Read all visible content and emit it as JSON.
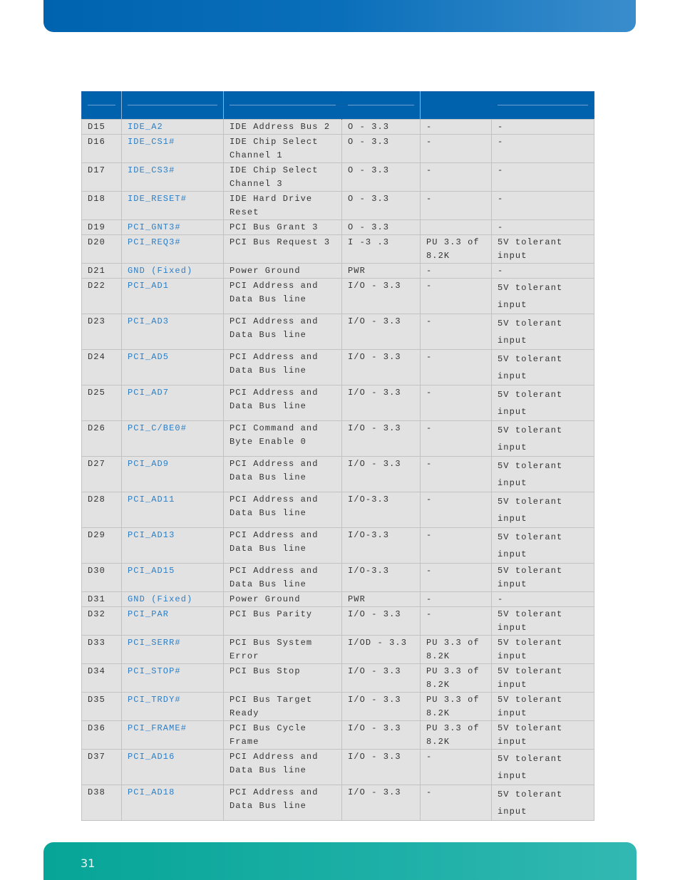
{
  "page_number": "31",
  "colors": {
    "header_band": "#0063b0",
    "footer_band": "#06a597",
    "table_header": "#0062ad",
    "signal_link": "#2e7ec4",
    "cell_bg": "#e2e2e2"
  },
  "table": {
    "headers": [
      "",
      "",
      "",
      "",
      "",
      ""
    ],
    "rows": [
      [
        "D15",
        "IDE_A2",
        "IDE Address Bus 2",
        "O - 3.3",
        "-",
        "-"
      ],
      [
        "D16",
        "IDE_CS1#",
        "IDE Chip Select\nChannel 1",
        "O - 3.3",
        "-",
        "-"
      ],
      [
        "D17",
        "IDE_CS3#",
        "IDE Chip Select\nChannel 3",
        "O - 3.3",
        "-",
        "-"
      ],
      [
        "D18",
        "IDE_RESET#",
        "IDE Hard Drive\nReset",
        "O - 3.3",
        "-",
        "-"
      ],
      [
        "D19",
        "PCI_GNT3#",
        "PCI Bus Grant 3",
        "O - 3.3",
        "",
        "-"
      ],
      [
        "D20",
        "PCI_REQ3#",
        "PCI Bus Request 3",
        "I -3 .3",
        "PU 3.3 of\n8.2K",
        "5V tolerant\ninput"
      ],
      [
        "D21",
        "GND (Fixed)",
        "Power Ground",
        "PWR",
        "-",
        "-"
      ],
      [
        "D22",
        "PCI_AD1",
        "PCI Address and\nData Bus line",
        "I/O - 3.3",
        "-",
        "5V tolerant\ninput"
      ],
      [
        "D23",
        "PCI_AD3",
        "PCI Address and\nData Bus line",
        "I/O - 3.3",
        "-",
        "5V tolerant\ninput"
      ],
      [
        "D24",
        "PCI_AD5",
        "PCI Address and\nData Bus line",
        "I/O - 3.3",
        "-",
        "5V tolerant\ninput"
      ],
      [
        "D25",
        "PCI_AD7",
        "PCI Address and\nData Bus line",
        "I/O - 3.3",
        "-",
        "5V tolerant\ninput"
      ],
      [
        "D26",
        "PCI_C/BE0#",
        "PCI Command and\nByte Enable 0",
        "I/O - 3.3",
        "-",
        "5V tolerant\ninput"
      ],
      [
        "D27",
        "PCI_AD9",
        "PCI Address and\nData Bus line",
        "I/O - 3.3",
        "-",
        "5V tolerant\ninput"
      ],
      [
        "D28",
        "PCI_AD11",
        "PCI Address and\nData Bus line",
        "I/O-3.3",
        "-",
        "5V tolerant\ninput"
      ],
      [
        "D29",
        "PCI_AD13",
        "PCI Address and\nData Bus line",
        "I/O-3.3",
        "-",
        "5V tolerant\ninput"
      ],
      [
        "D30",
        "PCI_AD15",
        "PCI Address and\nData Bus line",
        "I/O-3.3",
        "-",
        "5V tolerant\ninput"
      ],
      [
        "D31",
        "GND (Fixed)",
        "Power Ground",
        "PWR",
        "-",
        "-"
      ],
      [
        "D32",
        "PCI_PAR",
        "PCI Bus Parity",
        "I/O - 3.3",
        "-",
        "5V tolerant\ninput"
      ],
      [
        "D33",
        "PCI_SERR#",
        "PCI Bus System\nError",
        "I/OD - 3.3",
        "PU 3.3 of\n8.2K",
        "5V tolerant\ninput"
      ],
      [
        "D34",
        "PCI_STOP#",
        "PCI Bus Stop",
        "I/O - 3.3",
        "PU 3.3 of\n8.2K",
        "5V tolerant\ninput"
      ],
      [
        "D35",
        "PCI_TRDY#",
        "PCI Bus Target\nReady",
        "I/O - 3.3",
        "PU 3.3 of\n8.2K",
        "5V tolerant\ninput"
      ],
      [
        "D36",
        "PCI_FRAME#",
        "PCI Bus Cycle\nFrame",
        "I/O - 3.3",
        "PU 3.3 of\n8.2K",
        "5V tolerant\ninput"
      ],
      [
        "D37",
        "PCI_AD16",
        "PCI Address and\nData Bus line",
        "I/O - 3.3",
        "-",
        "5V tolerant\ninput"
      ],
      [
        "D38",
        "PCI_AD18",
        "PCI Address and\nData Bus line",
        "I/O - 3.3",
        "-",
        "5V tolerant\ninput"
      ]
    ]
  }
}
